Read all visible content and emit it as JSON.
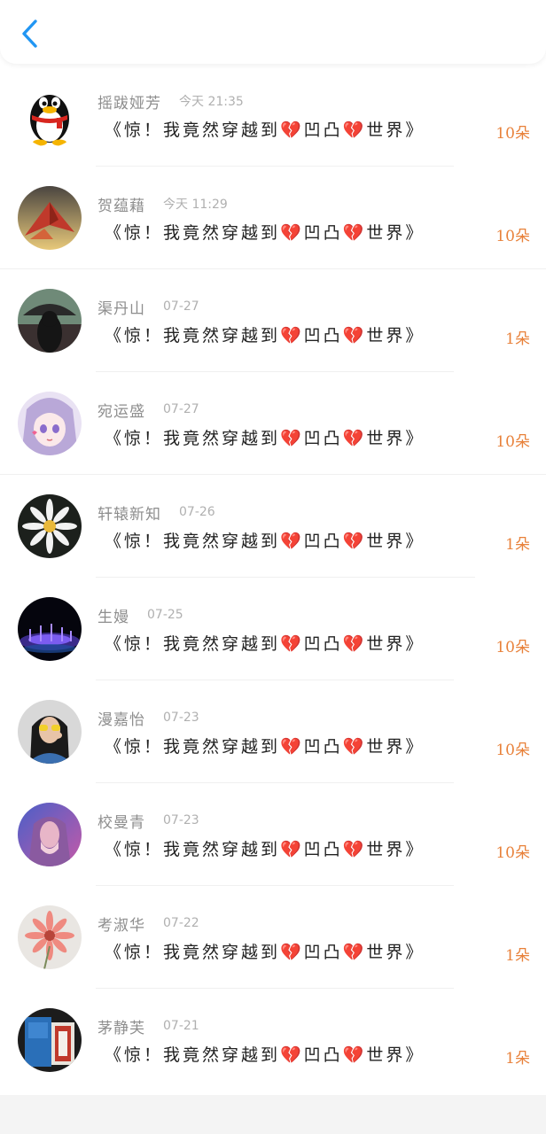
{
  "header": {
    "back_icon": "chevron-left-icon",
    "accent_color": "#2196F3"
  },
  "count_color": "#E8813A",
  "gifts": [
    {
      "name": "摇跋娅芳",
      "time": "今天 21:35",
      "message": "《惊！我竟然穿越到💔凹凸💔世界》",
      "count": "10朵",
      "avatar": "qq-penguin"
    },
    {
      "name": "贺蕴藉",
      "time": "今天 11:29",
      "message": "《惊！我竟然穿越到💔凹凸💔世界》",
      "count": "10朵",
      "avatar": "paper-crane"
    },
    {
      "name": "渠丹山",
      "time": "07-27",
      "message": "《惊！我竟然穿越到💔凹凸💔世界》",
      "count": "1朵",
      "avatar": "umbrella-silhouette"
    },
    {
      "name": "宛运盛",
      "time": "07-27",
      "message": "《惊！我竟然穿越到💔凹凸💔世界》",
      "count": "10朵",
      "avatar": "anime-girl"
    },
    {
      "name": "轩辕新知",
      "time": "07-26",
      "message": "《惊！我竟然穿越到💔凹凸💔世界》",
      "count": "1朵",
      "avatar": "daisy"
    },
    {
      "name": "生嫚",
      "time": "07-25",
      "message": "《惊！我竟然穿越到💔凹凸💔世界》",
      "count": "10朵",
      "avatar": "night-lights"
    },
    {
      "name": "漫嘉怡",
      "time": "07-23",
      "message": "《惊！我竟然穿越到💔凹凸💔世界》",
      "count": "10朵",
      "avatar": "girl-yellow-glasses"
    },
    {
      "name": "校曼青",
      "time": "07-23",
      "message": "《惊！我竟然穿越到💔凹凸💔世界》",
      "count": "10朵",
      "avatar": "purple-girl"
    },
    {
      "name": "考淑华",
      "time": "07-22",
      "message": "《惊！我竟然穿越到💔凹凸💔世界》",
      "count": "1朵",
      "avatar": "pink-gerbera"
    },
    {
      "name": "茅静芙",
      "time": "07-21",
      "message": "《惊！我竟然穿越到💔凹凸💔世界》",
      "count": "1朵",
      "avatar": "blue-window"
    }
  ]
}
